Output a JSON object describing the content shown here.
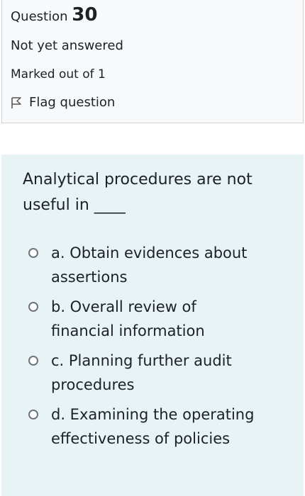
{
  "info": {
    "question_label": "Question",
    "question_number": "30",
    "state": "Not yet answered",
    "grade": "Marked out of 1",
    "flag_label": "Flag question"
  },
  "question": {
    "text": "Analytical procedures are not useful in ____",
    "answers": [
      {
        "label": "a. Obtain evidences about assertions"
      },
      {
        "label": "b. Overall review of financial information"
      },
      {
        "label": "c. Planning further audit procedures"
      },
      {
        "label": "d. Examining the operating effectiveness of policies"
      }
    ]
  },
  "icons": {
    "flag": "flag-outline-icon",
    "radio": "radio-unchecked"
  },
  "colors": {
    "info_background": "#f8f9fa",
    "question_background": "#e7f3f5",
    "text": "#1d2125"
  }
}
